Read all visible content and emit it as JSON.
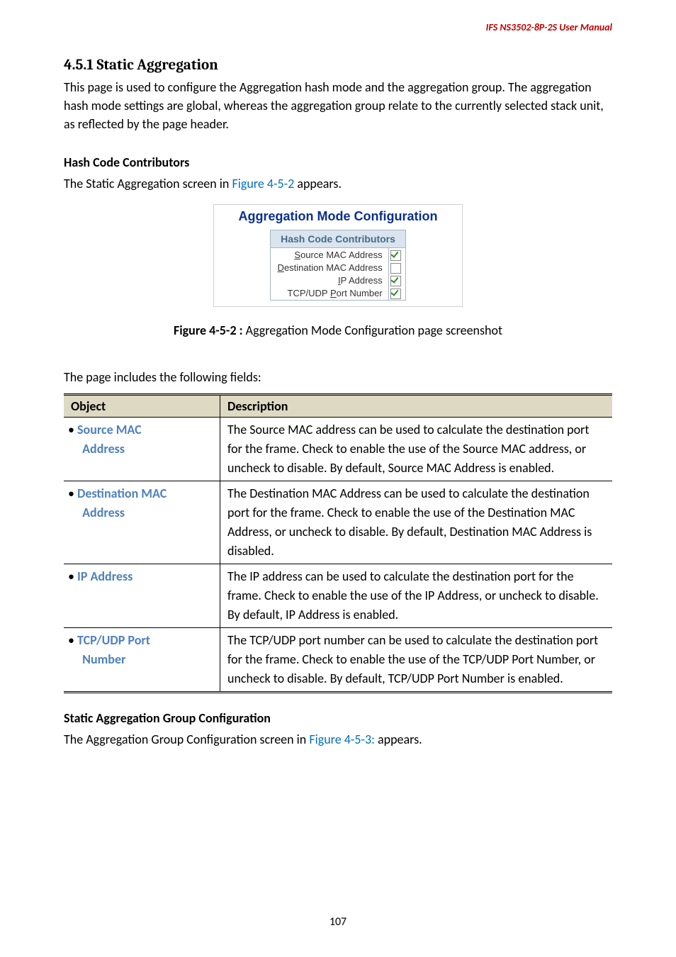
{
  "header": {
    "product": "IFS  NS3502-8P-2S  User  Manual"
  },
  "section": {
    "number": "4.5.1",
    "title": "Static Aggregation",
    "intro": "This page is used to configure the Aggregation hash mode and the aggregation group. The aggregation hash mode settings are global, whereas the aggregation group relate to the currently selected stack unit, as reflected by the page header."
  },
  "hash_section": {
    "heading": "Hash Code Contributors",
    "lead_pre": "The Static Aggregation screen in ",
    "lead_ref": "Figure 4-5-2",
    "lead_post": " appears."
  },
  "figure": {
    "panel_title": "Aggregation Mode Configuration",
    "table_header": "Hash Code Contributors",
    "rows": [
      {
        "label_pre": "",
        "u": "S",
        "label_post": "ource MAC Address",
        "checked": true
      },
      {
        "label_pre": "",
        "u": "D",
        "label_post": "estination MAC Address",
        "checked": false
      },
      {
        "label_pre": "",
        "u": "I",
        "label_post": "P Address",
        "checked": true
      },
      {
        "label_pre": "TCP/UDP ",
        "u": "P",
        "label_post": "ort Number",
        "checked": true
      }
    ],
    "caption_bold": "Figure 4-5-2 :",
    "caption_rest": " Aggregation Mode Configuration page screenshot"
  },
  "fields_intro": "The page includes the following fields:",
  "table": {
    "col_object": "Object",
    "col_desc": "Description",
    "rows": [
      {
        "name1": "Source MAC",
        "name2": "Address",
        "desc": "The Source MAC address can be used to calculate the destination port for the frame. Check to enable the use of the Source MAC address, or uncheck to disable. By default, Source MAC Address is enabled."
      },
      {
        "name1": "Destination MAC",
        "name2": "Address",
        "desc": "The Destination MAC Address can be used to calculate the destination port for the frame. Check to enable the use of the Destination MAC Address, or uncheck to disable. By default, Destination MAC Address is disabled."
      },
      {
        "name1": "IP Address",
        "name2": "",
        "desc": "The IP address can be used to calculate the destination port for the frame. Check to enable the use of the IP Address, or uncheck to disable. By default, IP Address is enabled."
      },
      {
        "name1": "TCP/UDP Port",
        "name2": "Number",
        "desc": "The TCP/UDP port number can be used to calculate the destination port for the frame. Check to enable the use of the TCP/UDP Port Number, or uncheck to disable. By default, TCP/UDP Port Number is enabled."
      }
    ]
  },
  "static_group": {
    "heading": "Static Aggregation Group Configuration",
    "lead_pre": "The Aggregation Group Configuration screen in ",
    "lead_ref": "Figure 4-5-3:",
    "lead_post": " appears."
  },
  "page_number": "107"
}
